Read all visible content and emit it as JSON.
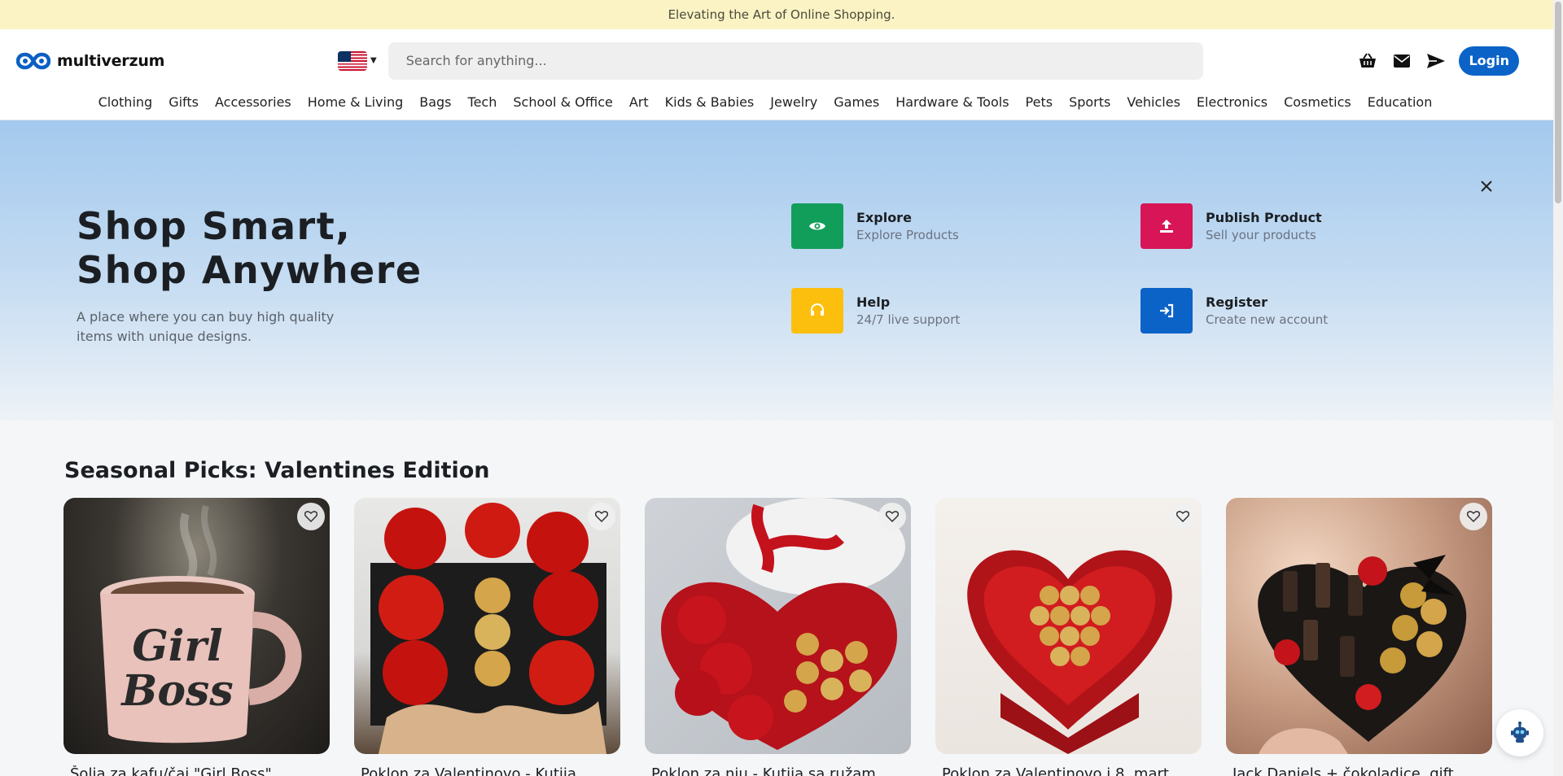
{
  "announcement": "Elevating the Art of Online Shopping.",
  "header": {
    "logo_text": "multiverzum",
    "search_placeholder": "Search for anything...",
    "login_label": "Login",
    "icons": [
      "basket-icon",
      "mail-icon",
      "send-icon"
    ],
    "language": "us-flag-icon"
  },
  "categories": [
    "Clothing",
    "Gifts",
    "Accessories",
    "Home & Living",
    "Bags",
    "Tech",
    "School & Office",
    "Art",
    "Kids & Babies",
    "Jewelry",
    "Games",
    "Hardware & Tools",
    "Pets",
    "Sports",
    "Vehicles",
    "Electronics",
    "Cosmetics",
    "Education"
  ],
  "hero": {
    "title_line1": "Shop Smart,",
    "title_line2": "Shop Anywhere",
    "subtitle": "A place where you can buy high quality items with unique designs.",
    "close_icon": "close-icon",
    "features": [
      {
        "title": "Explore",
        "subtitle": "Explore Products",
        "color": "#119e5a",
        "icon": "eye-icon"
      },
      {
        "title": "Publish Product",
        "subtitle": "Sell your products",
        "color": "#d81557",
        "icon": "upload-icon"
      },
      {
        "title": "Help",
        "subtitle": "24/7 live support",
        "color": "#fdbf0e",
        "icon": "headset-icon"
      },
      {
        "title": "Register",
        "subtitle": "Create new account",
        "color": "#0b63c8",
        "icon": "sign-in-icon"
      }
    ]
  },
  "section": {
    "title": "Seasonal Picks: Valentines Edition",
    "products": [
      {
        "name": "Šolja za kafu/čaj \"Girl Boss\""
      },
      {
        "name": "Poklon za Valentinovo - Kutija"
      },
      {
        "name": "Poklon za nju - Kutija sa ružam"
      },
      {
        "name": "Poklon za Valentinovo i 8. mart"
      },
      {
        "name": "Jack Daniels + čokoladice, gift"
      }
    ]
  },
  "colors": {
    "announcement_bg": "#fbf3c4",
    "login_bg": "#0b63c8",
    "hero_top": "#a3c9ee"
  }
}
